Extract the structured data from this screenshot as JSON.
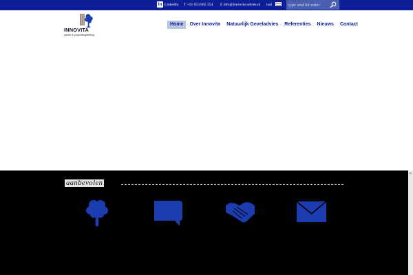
{
  "topbar": {
    "linkedin_label": "LinkedIn",
    "phone": "T +31 653 662 354",
    "email": "E info@innovita-advies.nl",
    "language": "taal",
    "search_placeholder": "type and hit enter"
  },
  "logo": {
    "name": "INNOVITA",
    "tagline": "advies & projectbegeleiding"
  },
  "nav": {
    "items": [
      {
        "label": "Home",
        "active": true
      },
      {
        "label": "Over Innovita",
        "active": false
      },
      {
        "label": "Natuurlijk Geveladvies",
        "active": false
      },
      {
        "label": "Referenties",
        "active": false
      },
      {
        "label": "Nieuws",
        "active": false
      },
      {
        "label": "Contact",
        "active": false
      }
    ]
  },
  "section": {
    "heading": "aanbevolen"
  },
  "features": [
    {
      "icon": "tree-icon"
    },
    {
      "icon": "speech-bubble-icon"
    },
    {
      "icon": "handshake-icon"
    },
    {
      "icon": "envelope-icon"
    }
  ],
  "colors": {
    "brand_blue": "#0d1f96",
    "icon_blue": "#1b3db0",
    "nav_active_bg": "#b8c3e0",
    "dark_section": "#000000",
    "flag_red": "#ae1c28",
    "flag_white": "#ffffff",
    "flag_blue": "#21468b"
  }
}
